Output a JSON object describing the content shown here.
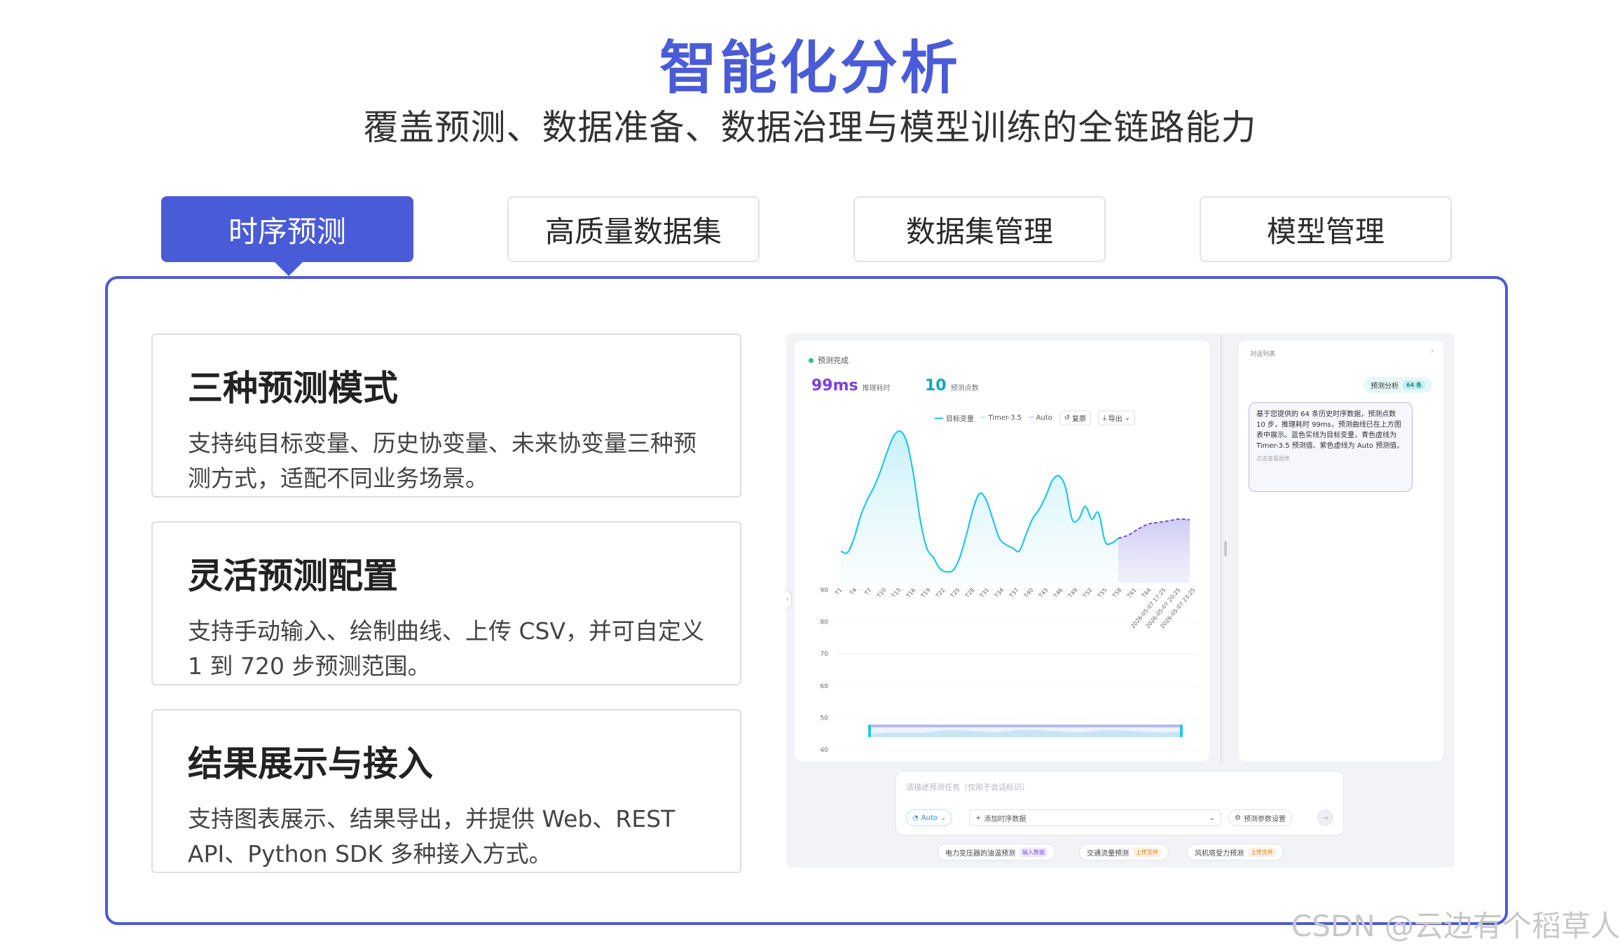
{
  "header": {
    "title": "智能化分析",
    "subtitle": "覆盖预测、数据准备、数据治理与模型训练的全链路能力"
  },
  "tabs": [
    {
      "label": "时序预测",
      "active": true
    },
    {
      "label": "高质量数据集",
      "active": false
    },
    {
      "label": "数据集管理",
      "active": false
    },
    {
      "label": "模型管理",
      "active": false
    }
  ],
  "features": [
    {
      "title": "三种预测模式",
      "desc": "支持纯目标变量、历史协变量、未来协变量三种预测方式，适配不同业务场景。"
    },
    {
      "title": "灵活预测配置",
      "desc": "支持手动输入、绘制曲线、上传 CSV，并可自定义 1 到 720 步预测范围。"
    },
    {
      "title": "结果展示与接入",
      "desc": "支持图表展示、结果导出，并提供 Web、REST API、Python SDK 多种接入方式。"
    }
  ],
  "app": {
    "status": "预测完成",
    "metrics": [
      {
        "value": "99ms",
        "label": "推理耗时",
        "color": "#7b3fe4"
      },
      {
        "value": "10",
        "label": "预测点数",
        "color": "#16a3b8"
      }
    ],
    "legend": {
      "target": "目标变量",
      "timer": "Timer-3.5",
      "auto": "Auto",
      "reset": "复原",
      "export": "导出"
    },
    "sidebar": {
      "header": "对话列表",
      "chip_label": "预测分析",
      "chip_count": "64 条",
      "message": "基于您提供的 64 条历史时序数据，预测点数 10 步，推理耗时 99ms，预测曲线已在上方图表中展示。蓝色实线为目标变量，青色虚线为 Timer-3.5 预测值、紫色虚线为 Auto 预测值。",
      "message_foot": "点击查看图表"
    },
    "input": {
      "placeholder": "请描述预测任务（仅用于会话标识）",
      "model": "Auto",
      "add_data": "添加时序数据",
      "params": "预测参数设置"
    },
    "presets": [
      {
        "label": "电力变压器的油温预测",
        "tag": "输入数据"
      },
      {
        "label": "交通流量预测",
        "tag": "上传文件"
      },
      {
        "label": "风机塔受力预测",
        "tag": "上传文件"
      }
    ]
  },
  "chart_data": {
    "type": "line",
    "ylim": [
      40,
      90
    ],
    "yticks": [
      40,
      50,
      60,
      70,
      80,
      90
    ],
    "xticks": [
      "T1",
      "T4",
      "T7",
      "T10",
      "T13",
      "T16",
      "T19",
      "T22",
      "T25",
      "T28",
      "T31",
      "T34",
      "T37",
      "T40",
      "T43",
      "T46",
      "T49",
      "T52",
      "T55",
      "T58",
      "T61",
      "T64",
      "2026-05-07 17:25",
      "2026-05-07 20:25",
      "2026-05-07 23:25"
    ],
    "series": [
      {
        "name": "目标变量",
        "color": "#22c7e8",
        "style": "solid",
        "values": [
          50,
          49.5,
          54,
          61,
          66,
          70,
          75,
          81,
          86,
          87.5,
          84,
          74,
          60,
          51,
          48,
          44.5,
          43.5,
          44,
          48,
          55,
          63,
          68,
          66,
          60,
          54,
          52,
          51,
          50,
          55,
          60,
          63,
          67,
          72,
          73.5,
          70,
          60,
          60,
          64,
          60,
          62,
          53,
          52.5,
          54
        ]
      },
      {
        "name": "Auto",
        "color": "#7b4ddb",
        "style": "dashed",
        "values": [
          54,
          55,
          57,
          58.5,
          59,
          59.5,
          60,
          59.8
        ]
      }
    ]
  },
  "watermark": "CSDN @云边有个稻草人",
  "colors": {
    "brand": "#4a5bd8"
  }
}
